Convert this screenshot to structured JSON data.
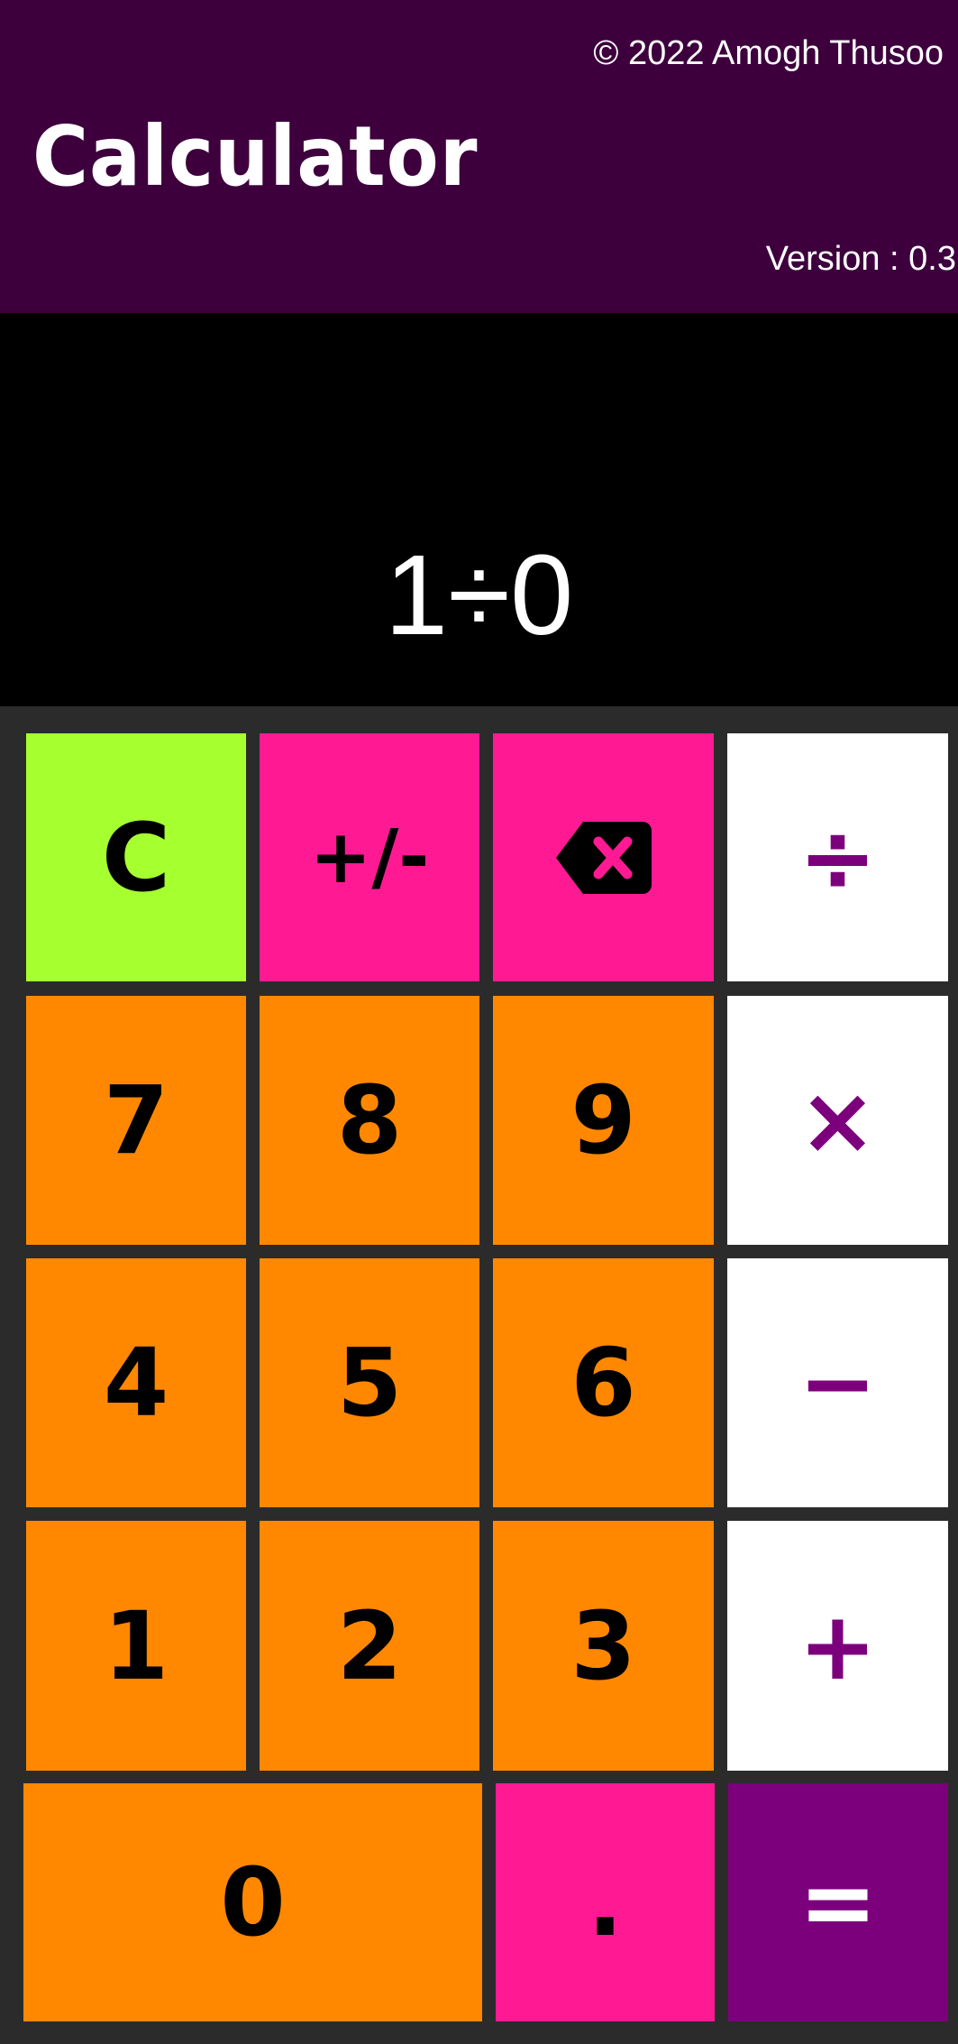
{
  "header": {
    "copyright": "© 2022 Amogh Thusoo",
    "title": "Calculator",
    "version": "Version : 0.3"
  },
  "display": {
    "expression": "1÷0"
  },
  "keys": {
    "clear": "C",
    "sign": "+/-",
    "divide": "÷",
    "seven": "7",
    "eight": "8",
    "nine": "9",
    "multiply": "×",
    "four": "4",
    "five": "5",
    "six": "6",
    "subtract": "−",
    "one": "1",
    "two": "2",
    "three": "3",
    "add": "+",
    "zero": "0",
    "decimal": ".",
    "equals": "="
  },
  "icons": {
    "backspace": "backspace-icon"
  },
  "colors": {
    "header_bg": "#3d003d",
    "display_bg": "#000000",
    "keypad_bg": "#2b2b2b",
    "clear_key": "#a6ff2e",
    "function_keys": "#ff1a94",
    "digit_keys": "#ff8800",
    "operator_keys": "#ffffff",
    "operator_text": "#7c007c",
    "equals_key": "#7c007c"
  }
}
